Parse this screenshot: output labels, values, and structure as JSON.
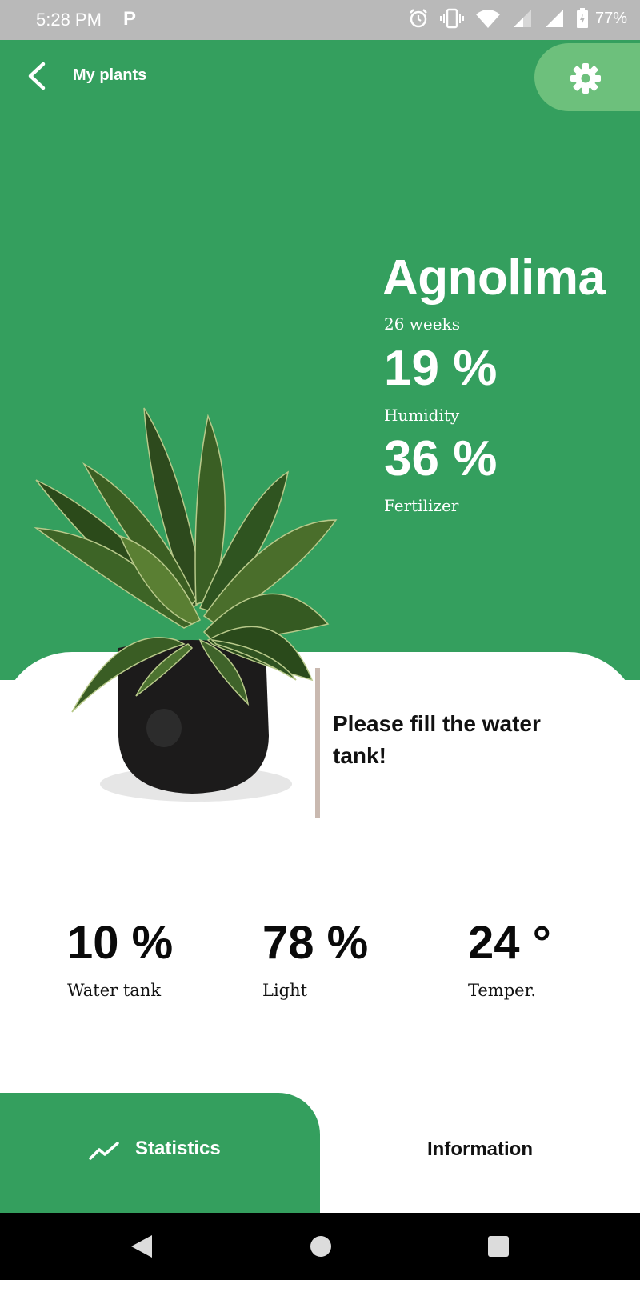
{
  "status_bar": {
    "time": "5:28 PM",
    "app_badge": "P",
    "battery": "77%",
    "icons": [
      "alarm-icon",
      "vibrate-icon",
      "wifi-icon",
      "signal-icon",
      "signal-icon",
      "battery-icon"
    ]
  },
  "header": {
    "back_icon": "chevron-left-icon",
    "title": "My plants",
    "settings_icon": "gear-icon"
  },
  "plant": {
    "name": "Agnolima",
    "age": "26 weeks",
    "humidity_value": "19 %",
    "humidity_label": "Humidity",
    "fertilizer_value": "36 %",
    "fertilizer_label": "Fertilizer"
  },
  "alert": {
    "message": "Please fill the water tank!"
  },
  "metrics": [
    {
      "value": "10 %",
      "label": "Water tank"
    },
    {
      "value": "78 %",
      "label": "Light"
    },
    {
      "value": "24 °",
      "label": "Temper."
    }
  ],
  "tabs": {
    "statistics": {
      "label": "Statistics",
      "icon": "trend-line-icon"
    },
    "information": {
      "label": "Information"
    }
  },
  "nav": [
    "back-triangle-icon",
    "home-circle-icon",
    "recents-square-icon"
  ],
  "colors": {
    "primary_green": "#349f5e",
    "light_green": "#6dc07c",
    "alert_bar": "#c9b9b0"
  }
}
